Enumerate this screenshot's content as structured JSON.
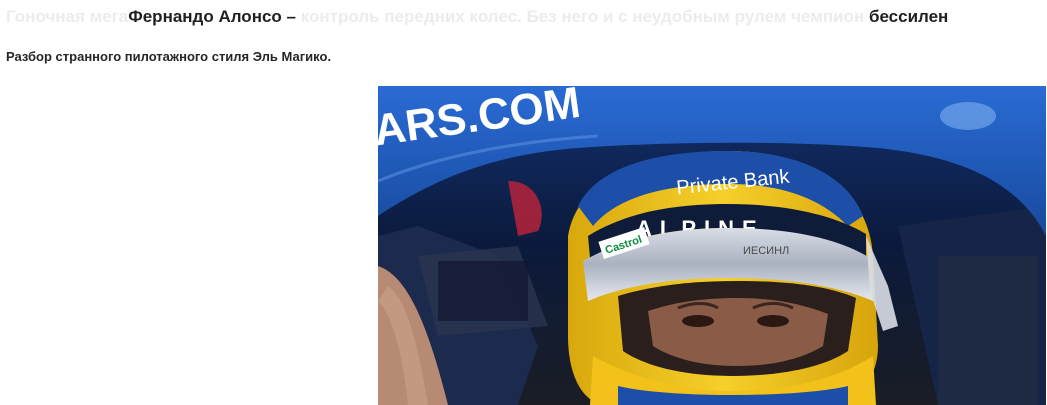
{
  "article": {
    "headline_faded_prefix": "Гоночная мега",
    "headline_name": "Фернандо Алонсо –",
    "headline_faded_middle": " контроль передних колес. Без него и с неудобным рулем чемпион ",
    "headline_end": "бессилен",
    "subtitle": "Разбор странного пилотажного стиля Эль Магико."
  },
  "photo": {
    "halo_text": "ARS.COM",
    "visor_text": "Private Bank",
    "helmet_band_text": "ALPINE",
    "sticker_text": "Castrol",
    "helmet_text_small": "ИЕСИНЛ"
  },
  "colors": {
    "halo_blue": "#1f5fc4",
    "helmet_yellow": "#f3c51b",
    "background_white": "#ffffff"
  }
}
